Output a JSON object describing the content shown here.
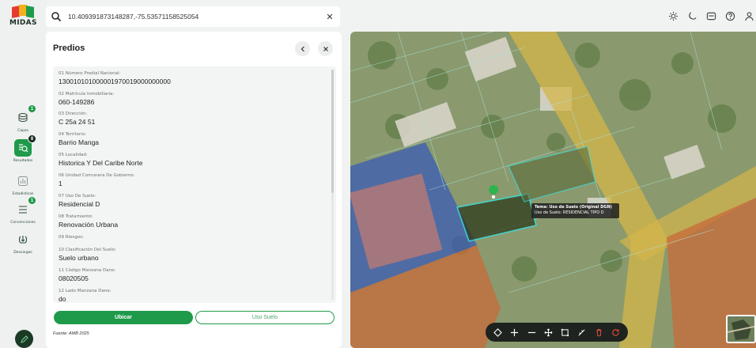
{
  "app": {
    "logo_text": "MIDAS",
    "colors": {
      "accent": "#1f9a4a",
      "dark": "#1b3a26"
    }
  },
  "search": {
    "value": "10.409391873148287,-75.53571158525054",
    "icon": "search-icon",
    "clear_icon": "close-icon"
  },
  "top_actions": [
    "sun-icon",
    "moon-icon",
    "mail-icon",
    "help-icon",
    "user-icon"
  ],
  "rail": {
    "items": [
      {
        "label": "Capas",
        "icon": "layers-icon",
        "badge": "1"
      },
      {
        "label": "Resultados",
        "icon": "results-icon",
        "badge": "8",
        "active": true
      },
      {
        "label": "Estadisticas",
        "icon": "stats-icon"
      },
      {
        "label": "Convenciones",
        "icon": "legend-icon",
        "badge": "1"
      },
      {
        "label": "Descargas",
        "icon": "download-icon"
      }
    ]
  },
  "panel": {
    "title": "Predios",
    "fields": [
      {
        "label": "01 Número Predial Nacional:",
        "value": "130010101000001970019000000000"
      },
      {
        "label": "02 Matrícula Inmobiliaria:",
        "value": "060-149286"
      },
      {
        "label": "03 Dirección:",
        "value": "C 25a 24 51"
      },
      {
        "label": "04 Territorio:",
        "value": "Barrio Manga"
      },
      {
        "label": "05 Localidad:",
        "value": "Historica Y Del Caribe Norte"
      },
      {
        "label": "06 Unidad Comunera De Gobierno:",
        "value": "1"
      },
      {
        "label": "07 Uso De Suelo:",
        "value": "Residencial D"
      },
      {
        "label": "08 Tratamiento:",
        "value": "Renovación Urbana"
      },
      {
        "label": "09 Riesgos:",
        "value": ""
      },
      {
        "label": "10 Clasificación Del Suelo:",
        "value": "Suelo urbano"
      },
      {
        "label": "11 Código Manzana Dane:",
        "value": "08020505"
      },
      {
        "label": "12 Lado Manzana Dane:",
        "value": "do"
      }
    ],
    "primary_button": "Ubicar",
    "secondary_button": "Uso Suelo",
    "source": "Fuente: AMB 2025"
  },
  "map": {
    "tooltip": {
      "title": "Tema: Uso de Suelo (Original DGN)",
      "body": "Uso de Suelo: RESIDENCIAL TIPO D"
    },
    "tools": [
      "polygon-icon",
      "zoom-in-icon",
      "zoom-out-icon",
      "pan-icon",
      "draw-icon",
      "measure-icon",
      "delete-icon",
      "refresh-icon"
    ]
  }
}
